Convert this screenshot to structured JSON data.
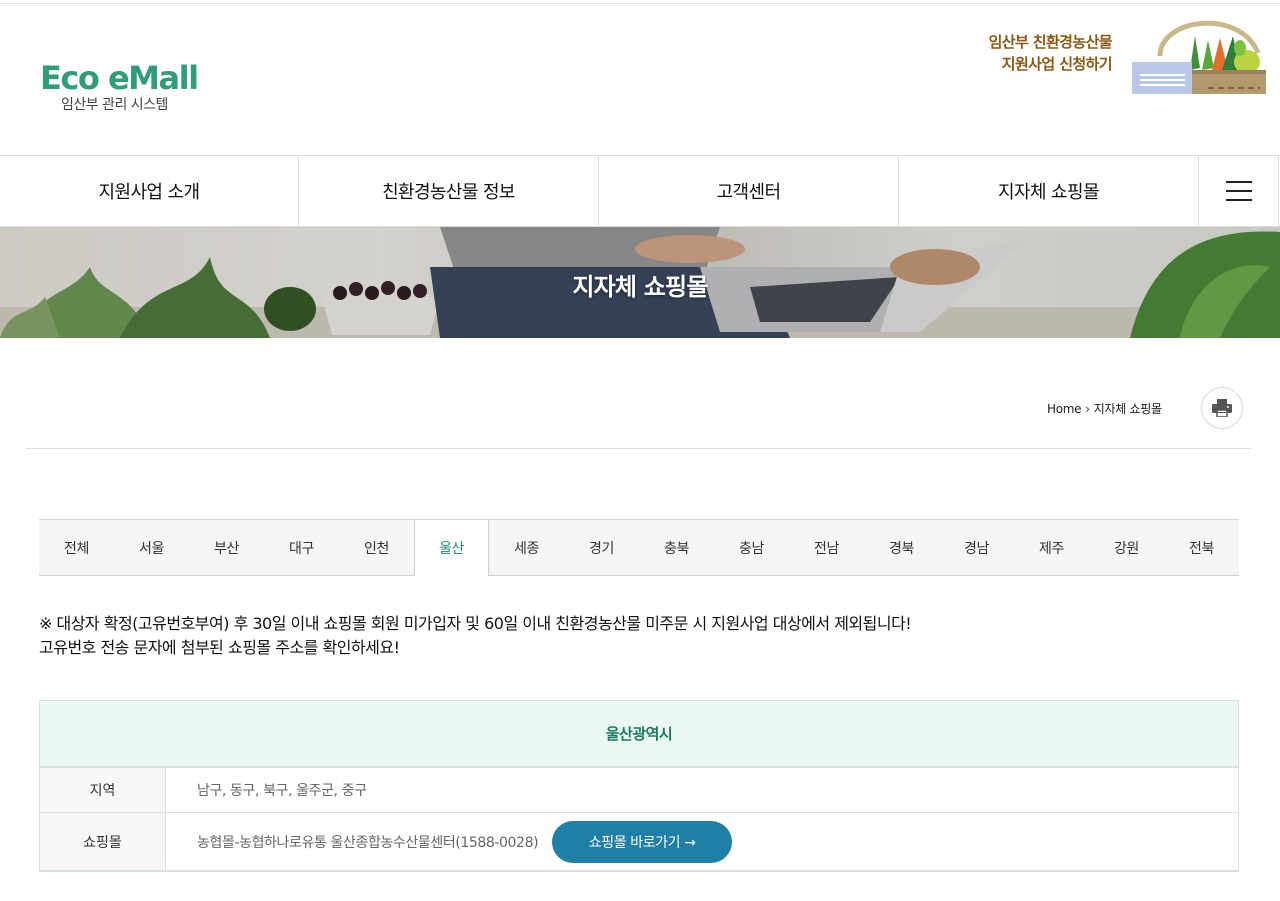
{
  "header": {
    "logo_title": "Eco eMall",
    "logo_subtitle": "임산부 관리 시스템",
    "apply_line1": "임산부 친환경농산물",
    "apply_line2": "지원사업 신청하기"
  },
  "nav": {
    "items": [
      {
        "label": "지원사업 소개"
      },
      {
        "label": "친환경농산물 정보"
      },
      {
        "label": "고객센터"
      },
      {
        "label": "지자체 쇼핑몰"
      }
    ],
    "menu_icon": "hamburger-icon"
  },
  "banner": {
    "title": "지자체 쇼핑몰"
  },
  "breadcrumb": {
    "home": "Home",
    "current": "지자체 쇼핑몰",
    "print_icon": "printer-icon"
  },
  "tabs": {
    "items": [
      {
        "label": "전체"
      },
      {
        "label": "서울"
      },
      {
        "label": "부산"
      },
      {
        "label": "대구"
      },
      {
        "label": "인천"
      },
      {
        "label": "울산"
      },
      {
        "label": "세종"
      },
      {
        "label": "경기"
      },
      {
        "label": "충북"
      },
      {
        "label": "충남"
      },
      {
        "label": "전남"
      },
      {
        "label": "경북"
      },
      {
        "label": "경남"
      },
      {
        "label": "제주"
      },
      {
        "label": "강원"
      },
      {
        "label": "전북"
      }
    ],
    "selected": "울산"
  },
  "notice": {
    "line1": "※ 대상자 확정(고유번호부여) 후 30일 이내 쇼핑몰 회원 미가입자 및 60일 이내 친환경농산물 미주문 시 지원사업 대상에서 제외됩니다!",
    "line2": "고유번호 전송 문자에 첨부된 쇼핑몰 주소를 확인하세요!"
  },
  "table": {
    "title": "울산광역시",
    "region_label": "지역",
    "region_value": "남구, 동구, 북구, 울주군, 중구",
    "mall_label": "쇼핑몰",
    "mall_value": "농협몰-농협하나로유통 울산종합농수산물센터(1588-0028)",
    "mall_button": "쇼핑몰 바로가기 →"
  },
  "colors": {
    "brand_green": "#2f9c7a",
    "apply_brown": "#8a5a14",
    "button_blue": "#1f7fa6",
    "table_head_bg": "#eaf7f2"
  }
}
